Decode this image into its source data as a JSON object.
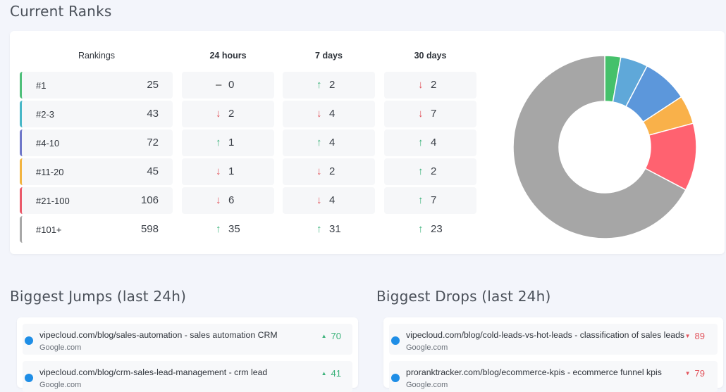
{
  "titles": {
    "current_ranks": "Current Ranks",
    "biggest_jumps": "Biggest Jumps (last 24h)",
    "biggest_drops": "Biggest Drops (last 24h)"
  },
  "table": {
    "headers": [
      "Rankings",
      "24 hours",
      "7 days",
      "30 days"
    ],
    "rows": [
      {
        "label": "#1",
        "count": "25",
        "color": "#4fbf7a",
        "h24": {
          "dir": "flat",
          "val": "0"
        },
        "d7": {
          "dir": "up",
          "val": "2"
        },
        "d30": {
          "dir": "down",
          "val": "2"
        }
      },
      {
        "label": "#2-3",
        "count": "43",
        "color": "#48b7c7",
        "h24": {
          "dir": "down",
          "val": "2"
        },
        "d7": {
          "dir": "down",
          "val": "4"
        },
        "d30": {
          "dir": "down",
          "val": "7"
        }
      },
      {
        "label": "#4-10",
        "count": "72",
        "color": "#6f77c9",
        "h24": {
          "dir": "up",
          "val": "1"
        },
        "d7": {
          "dir": "up",
          "val": "4"
        },
        "d30": {
          "dir": "up",
          "val": "4"
        }
      },
      {
        "label": "#11-20",
        "count": "45",
        "color": "#f2b441",
        "h24": {
          "dir": "down",
          "val": "1"
        },
        "d7": {
          "dir": "down",
          "val": "2"
        },
        "d30": {
          "dir": "up",
          "val": "2"
        }
      },
      {
        "label": "#21-100",
        "count": "106",
        "color": "#ea5a6a",
        "h24": {
          "dir": "down",
          "val": "6"
        },
        "d7": {
          "dir": "down",
          "val": "4"
        },
        "d30": {
          "dir": "up",
          "val": "7"
        }
      },
      {
        "label": "#101+",
        "count": "598",
        "color": "#a8a8a8",
        "h24": {
          "dir": "up",
          "val": "35"
        },
        "d7": {
          "dir": "up",
          "val": "31"
        },
        "d30": {
          "dir": "up",
          "val": "23"
        }
      }
    ]
  },
  "donut": {
    "segments": [
      {
        "value": 25,
        "color": "#45c16b"
      },
      {
        "value": 43,
        "color": "#5fa8d9"
      },
      {
        "value": 72,
        "color": "#5c97db"
      },
      {
        "value": 45,
        "color": "#f9b14a"
      },
      {
        "value": 106,
        "color": "#ff6270"
      },
      {
        "value": 598,
        "color": "#a6a6a6"
      }
    ]
  },
  "jumps": [
    {
      "url": "vipecloud.com/blog/sales-automation - sales automation CRM",
      "source": "Google.com",
      "value": "70"
    },
    {
      "url": "vipecloud.com/blog/crm-sales-lead-management - crm lead",
      "source": "Google.com",
      "value": "41"
    }
  ],
  "drops": [
    {
      "url": "vipecloud.com/blog/cold-leads-vs-hot-leads - classification of sales leads",
      "source": "Google.com",
      "value": "89"
    },
    {
      "url": "proranktracker.com/blog/ecommerce-kpis - ecommerce funnel kpis",
      "source": "Google.com",
      "value": "79"
    }
  ],
  "arrows": {
    "up": "↑",
    "down": "↓",
    "flat": "–",
    "tri_up": "▲",
    "tri_down": "▼"
  }
}
